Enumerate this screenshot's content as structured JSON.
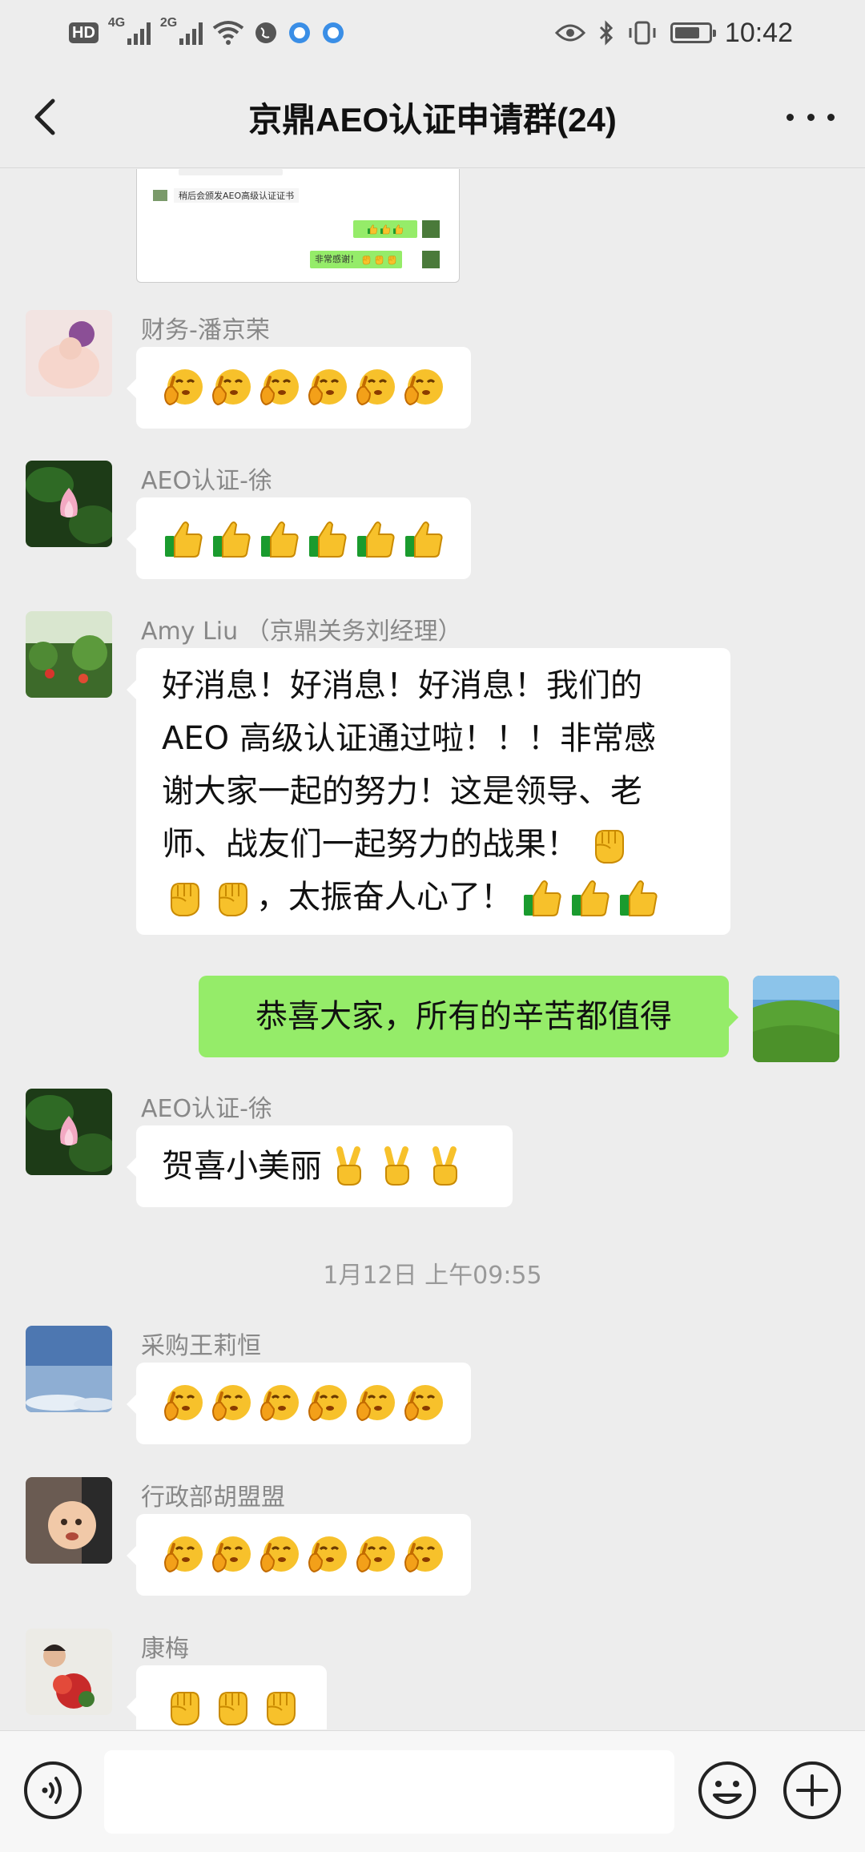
{
  "status_bar": {
    "hd": "HD",
    "sim1": "4G",
    "sim2": "2G",
    "time": "10:42",
    "battery_level": 0.75
  },
  "header": {
    "title": "京鼎AEO认证申请群(24)",
    "back_icon": "chevron-left-icon",
    "more_icon": "more-dots-icon"
  },
  "forwarded_card": {
    "line1": "稍后会颁发AEO高级认证证书",
    "line2": "非常感谢！",
    "emoji": [
      "thumbs-up",
      "thumbs-up",
      "thumbs-up"
    ]
  },
  "messages": [
    {
      "sender": "财务-潘京荣",
      "kind": "emoji",
      "emoji": "shushing-face",
      "count": 6
    },
    {
      "sender": "AEO认证-徐",
      "kind": "emoji",
      "emoji": "thumbs-up",
      "count": 6
    },
    {
      "sender": "Amy Liu （京鼎关务刘经理）",
      "kind": "text",
      "lines": [
        "好消息！好消息！好消息！我们的",
        "AEO 高级认证通过啦！！！非常感",
        "谢大家一起的努力！这是领导、老",
        "师、战友们一起努力的战果！",
        "，太振奋人心了！"
      ]
    },
    {
      "sender": "",
      "kind": "self",
      "text": "恭喜大家，所有的辛苦都值得"
    },
    {
      "sender": "AEO认证-徐",
      "kind": "text",
      "text": "贺喜小美丽"
    },
    {
      "sender": "采购王莉恒",
      "kind": "emoji",
      "emoji": "shushing-face",
      "count": 6
    },
    {
      "sender": "行政部胡盟盟",
      "kind": "emoji",
      "emoji": "shushing-face",
      "count": 6
    },
    {
      "sender": "康梅",
      "kind": "emoji",
      "emoji": "raised-fist",
      "count": 3
    }
  ],
  "time_separator": "1月12日 上午09:55",
  "input_bar": {
    "voice_icon": "voice-icon",
    "input_value": "",
    "emoji_icon": "emoji-icon",
    "plus_icon": "plus-icon"
  },
  "colors": {
    "background": "#ededed",
    "self_bubble": "#95ec69",
    "other_bubble": "#ffffff",
    "sender_name": "#888888"
  }
}
